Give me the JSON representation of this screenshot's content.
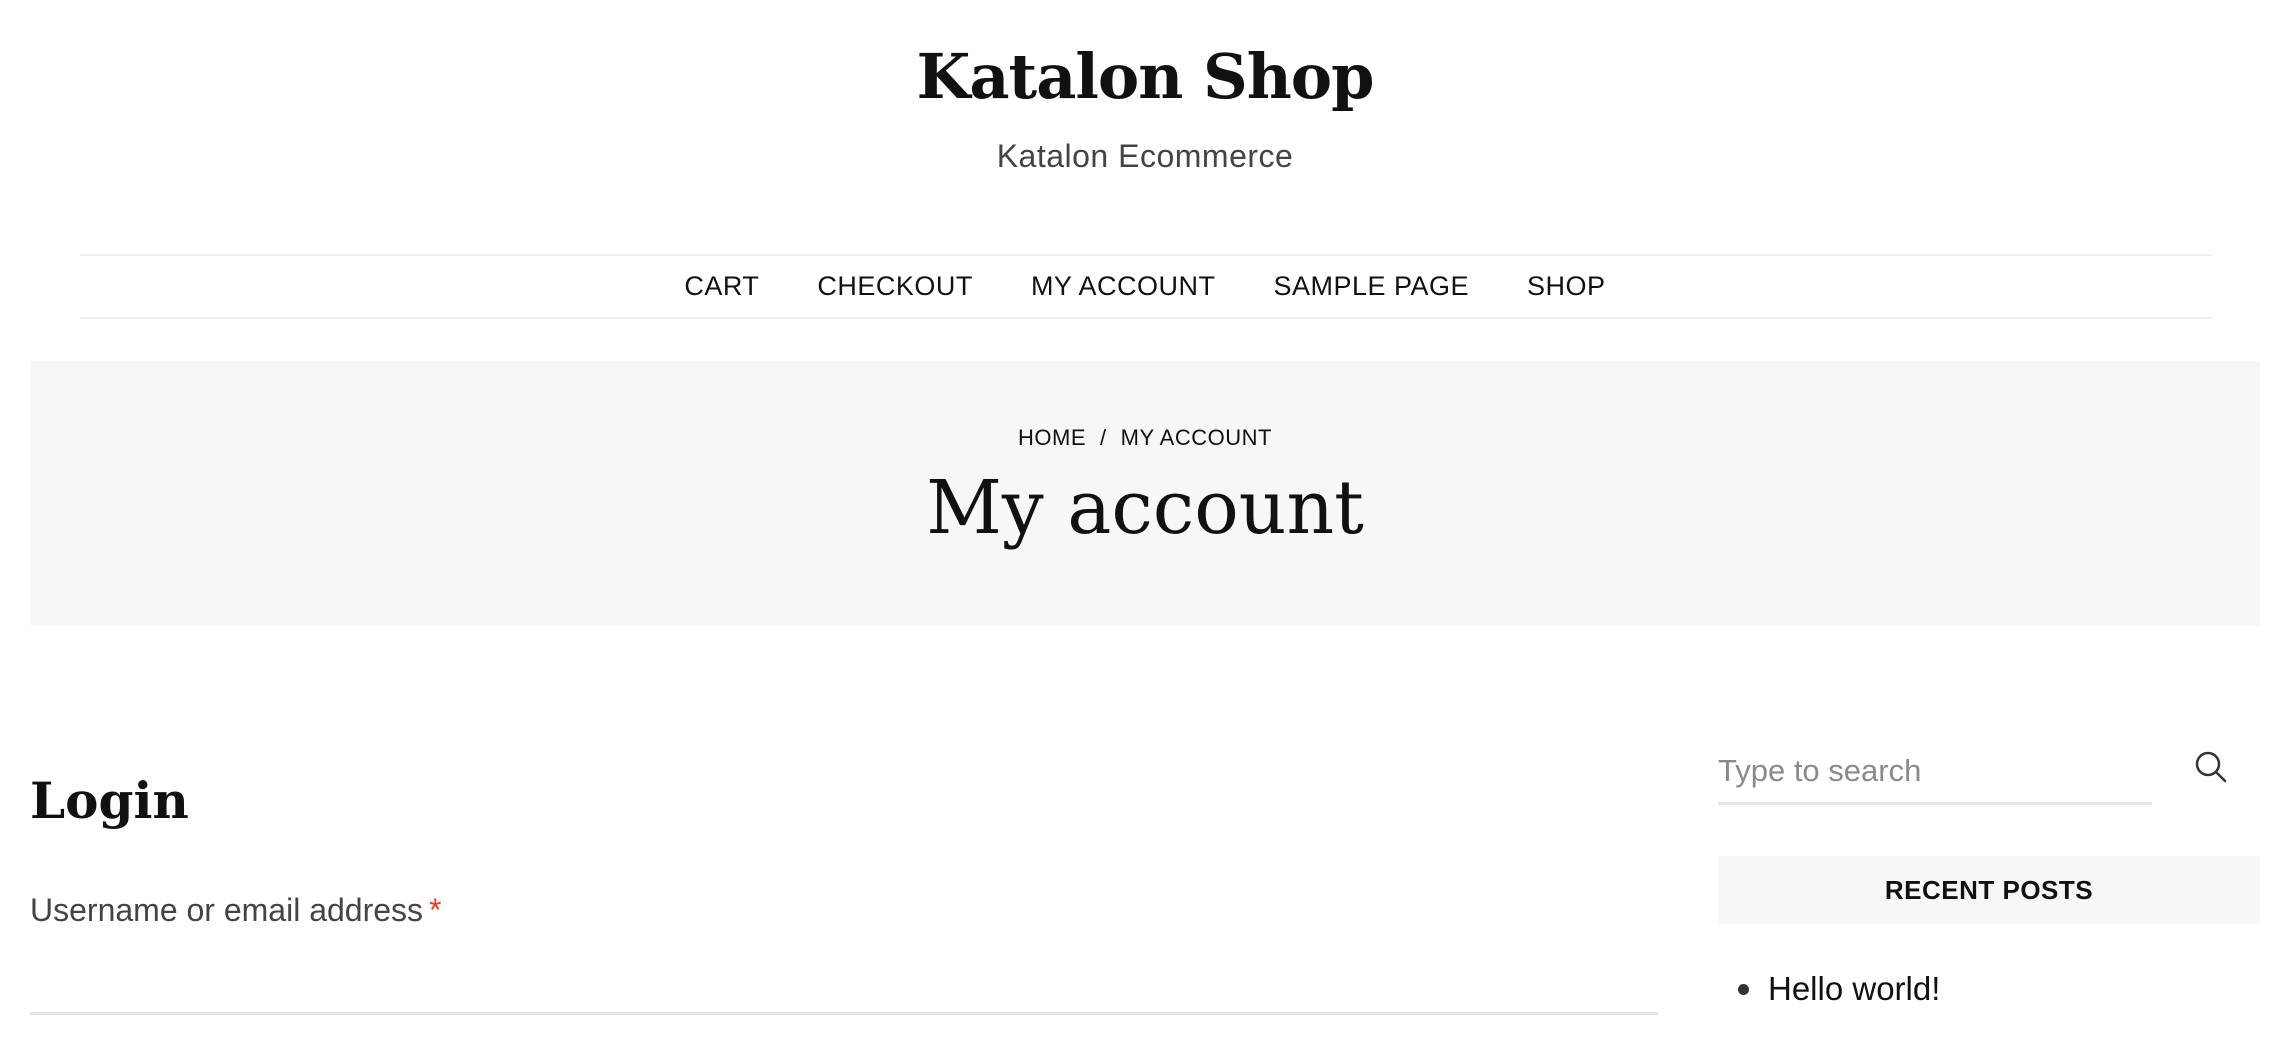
{
  "site": {
    "title": "Katalon Shop",
    "tagline": "Katalon Ecommerce"
  },
  "nav": {
    "items": [
      {
        "label": "CART"
      },
      {
        "label": "CHECKOUT"
      },
      {
        "label": "MY ACCOUNT"
      },
      {
        "label": "SAMPLE PAGE"
      },
      {
        "label": "SHOP"
      }
    ]
  },
  "hero": {
    "breadcrumb": {
      "home": "HOME",
      "separator": "/",
      "current": "MY ACCOUNT"
    },
    "title": "My account"
  },
  "login": {
    "heading": "Login",
    "username_label": "Username or email address",
    "required_mark": "*",
    "username_value": ""
  },
  "sidebar": {
    "search": {
      "placeholder": "Type to search",
      "icon": "search-icon"
    },
    "recent_posts": {
      "title": "RECENT POSTS",
      "items": [
        {
          "label": "Hello world!"
        }
      ]
    }
  },
  "colors": {
    "required": "#e2401c",
    "hero_bg": "#f7f7f7",
    "widget_bg": "#f7f7f7",
    "divider": "#e4e4e4"
  }
}
